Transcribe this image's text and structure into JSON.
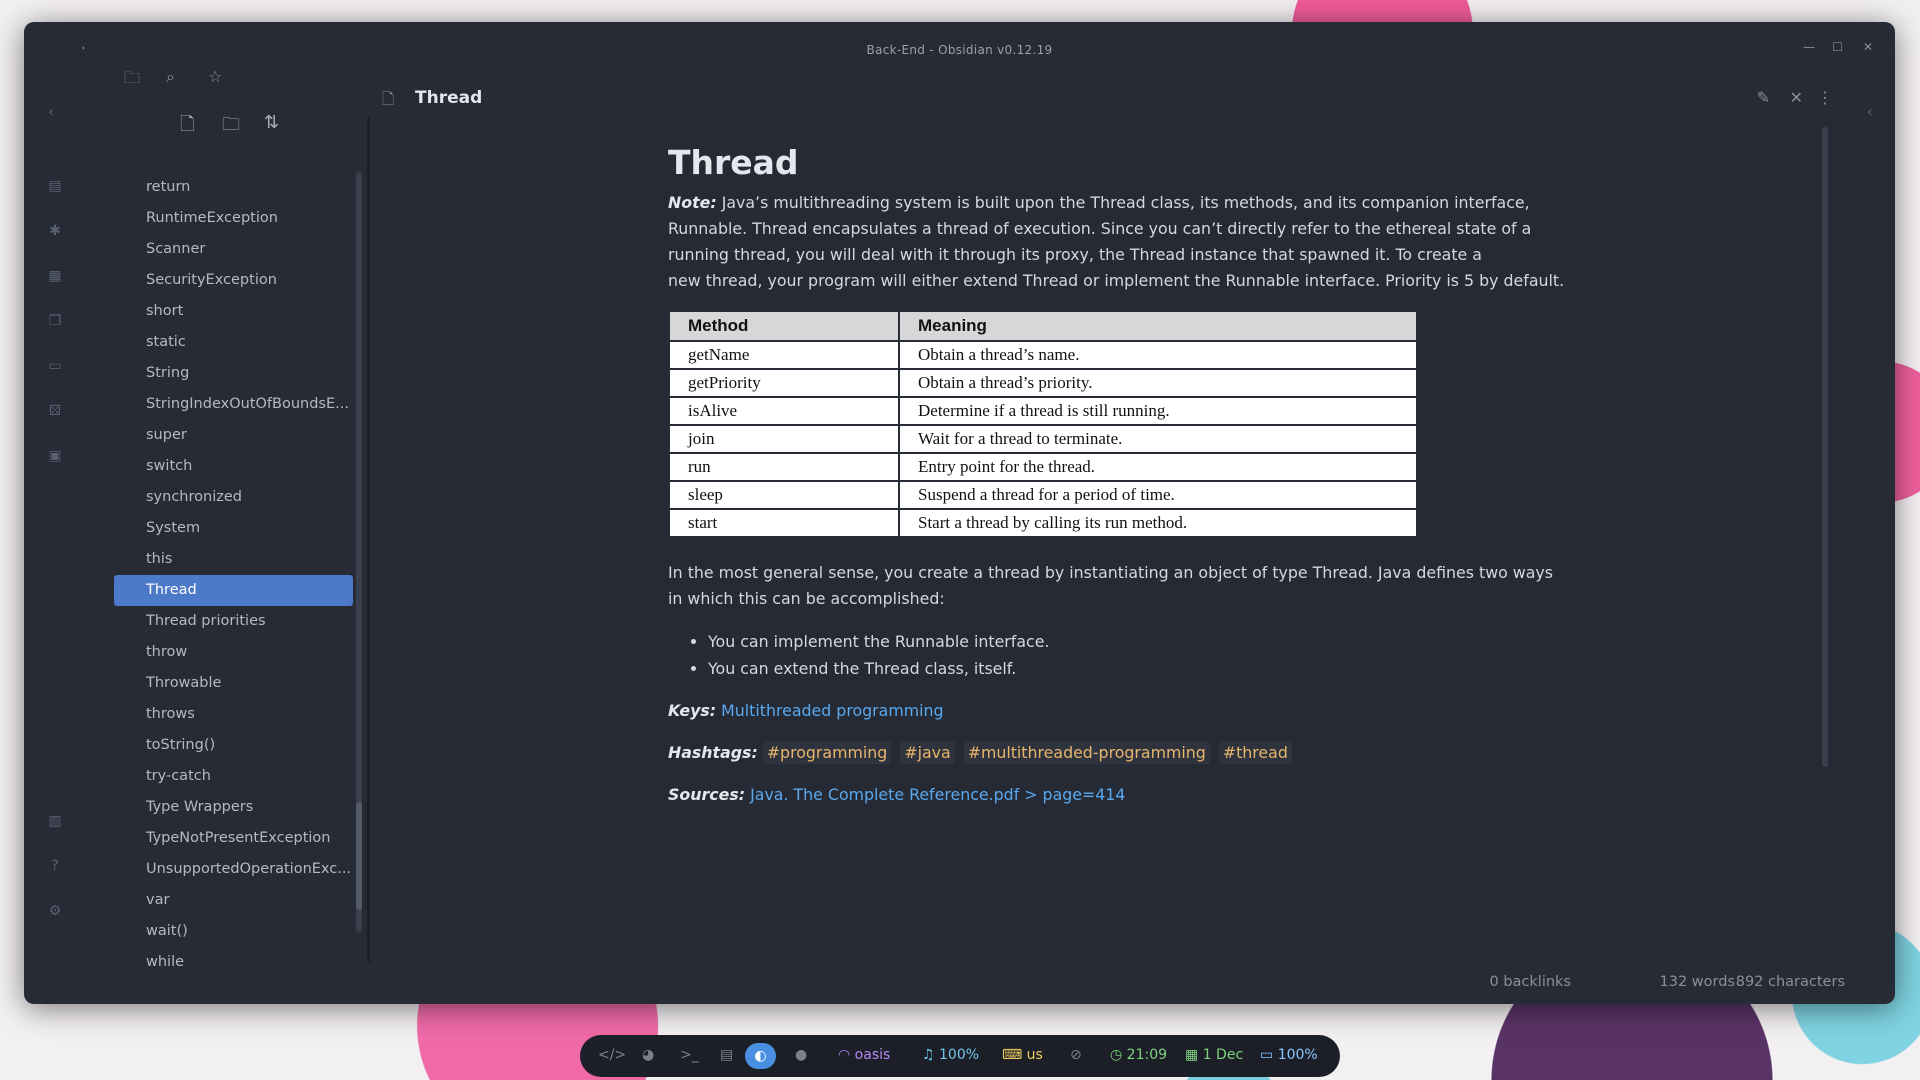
{
  "window": {
    "title": "Back-End - Obsidian v0.12.19",
    "back": "←",
    "forward": "→",
    "minimize": "—",
    "maximize": "☐",
    "close": "✕"
  },
  "sidebar": {
    "files": [
      {
        "label": "return"
      },
      {
        "label": "RuntimeException"
      },
      {
        "label": "Scanner"
      },
      {
        "label": "SecurityException"
      },
      {
        "label": "short"
      },
      {
        "label": "static"
      },
      {
        "label": "String"
      },
      {
        "label": "StringIndexOutOfBoundsE..."
      },
      {
        "label": "super"
      },
      {
        "label": "switch"
      },
      {
        "label": "synchronized"
      },
      {
        "label": "System"
      },
      {
        "label": "this"
      },
      {
        "label": "Thread"
      },
      {
        "label": "Thread priorities"
      },
      {
        "label": "throw"
      },
      {
        "label": "Throwable"
      },
      {
        "label": "throws"
      },
      {
        "label": "toString()"
      },
      {
        "label": "try-catch"
      },
      {
        "label": "Type Wrappers"
      },
      {
        "label": "TypeNotPresentException"
      },
      {
        "label": "UnsupportedOperationExc..."
      },
      {
        "label": "var"
      },
      {
        "label": "wait()"
      },
      {
        "label": "while"
      }
    ],
    "active_index": 13
  },
  "tab": {
    "title": "Thread"
  },
  "note": {
    "heading": "Thread",
    "note_label": "Note:",
    "paragraph1": "Java’s multithreading system is built upon the Thread class, its methods, and its companion interface, Runnable. Thread encapsulates a thread of execution. Since you can’t directly refer to the ethereal state of a running thread, you will deal with it through its proxy, the Thread instance that spawned it. To create a",
    "paragraph1b": "new thread, your program will either extend Thread or implement the Runnable interface. Priority is 5 by default.",
    "table": {
      "headers": [
        "Method",
        "Meaning"
      ],
      "rows": [
        [
          "getName",
          "Obtain a thread’s name."
        ],
        [
          "getPriority",
          "Obtain a thread’s priority."
        ],
        [
          "isAlive",
          "Determine if a thread is still running."
        ],
        [
          "join",
          "Wait for a thread to terminate."
        ],
        [
          "run",
          "Entry point for the thread."
        ],
        [
          "sleep",
          "Suspend a thread for a period of time."
        ],
        [
          "start",
          "Start a thread by calling its run method."
        ]
      ]
    },
    "paragraph2": "In the most general sense, you create a thread by instantiating an object of type Thread. Java defines two ways in which this can be accomplished:",
    "bullets": [
      "You can implement the Runnable interface.",
      "You can extend the Thread class, itself."
    ],
    "keys_label": "Keys:",
    "keys_link": "Multithreaded programming",
    "hashtags_label": "Hashtags:",
    "hashtags": [
      "#programming",
      "#java",
      "#multithreaded-programming",
      "#thread"
    ],
    "sources_label": "Sources:",
    "sources_link": "Java. The Complete Reference.pdf > page=414"
  },
  "status": {
    "backlinks": "0 backlinks",
    "words": "132 words",
    "characters": "892 characters"
  },
  "dock": {
    "wifi": "oasis",
    "volume": "100%",
    "keyboard": "us",
    "time": "21:09",
    "date": "1 Dec",
    "battery": "100%"
  },
  "colors": {
    "accent": "#4d79c9",
    "link": "#5aa8ee",
    "tag": "#e8b66b",
    "background": "#262b36"
  }
}
